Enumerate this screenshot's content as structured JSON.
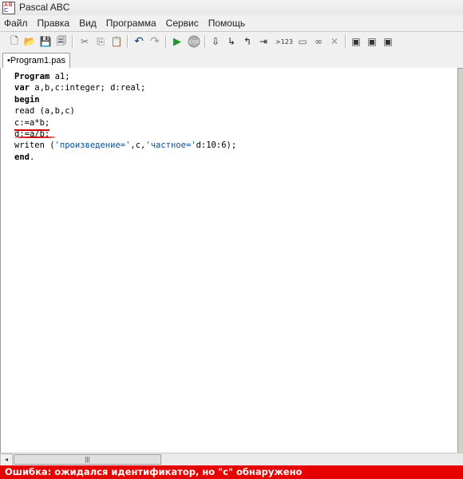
{
  "window": {
    "title": "Pascal ABC"
  },
  "menu": {
    "items": [
      "Файл",
      "Правка",
      "Вид",
      "Программа",
      "Сервис",
      "Помощь"
    ]
  },
  "toolbar": {
    "buttons": [
      {
        "name": "new-file-icon",
        "glyph": "🗋"
      },
      {
        "name": "open-folder-icon",
        "glyph": "📂"
      },
      {
        "name": "save-icon",
        "glyph": "💾"
      },
      {
        "name": "save-all-icon",
        "glyph": "🗐"
      },
      {
        "name": "cut-icon",
        "glyph": "✂"
      },
      {
        "name": "copy-icon",
        "glyph": "⎘"
      },
      {
        "name": "paste-icon",
        "glyph": "📋"
      },
      {
        "name": "undo-icon",
        "glyph": "↶"
      },
      {
        "name": "redo-icon",
        "glyph": "↷"
      },
      {
        "name": "run-icon",
        "glyph": "▶"
      },
      {
        "name": "stop-icon",
        "glyph": "●",
        "label": "STOP"
      },
      {
        "name": "step-over-icon",
        "glyph": "⇩"
      },
      {
        "name": "step-into-icon",
        "glyph": "↳"
      },
      {
        "name": "step-out-icon",
        "glyph": "↰"
      },
      {
        "name": "run-to-cursor-icon",
        "glyph": "⇥"
      },
      {
        "name": "evaluate-icon",
        "glyph": ">123"
      },
      {
        "name": "watch-window-icon",
        "glyph": "▭"
      },
      {
        "name": "breakpoints-icon",
        "glyph": "∞"
      },
      {
        "name": "clear-icon",
        "glyph": "✕"
      },
      {
        "name": "window-1-icon",
        "glyph": "▣"
      },
      {
        "name": "window-2-icon",
        "glyph": "▣"
      },
      {
        "name": "window-3-icon",
        "glyph": "▣"
      }
    ]
  },
  "tabs": [
    {
      "label": "•Program1.pas"
    }
  ],
  "editor": {
    "lines": [
      [
        {
          "t": "Program",
          "c": "kw"
        },
        {
          "t": " a1;",
          "c": ""
        }
      ],
      [
        {
          "t": "var",
          "c": "kw"
        },
        {
          "t": " a,b,c:integer; d:real;",
          "c": ""
        }
      ],
      [
        {
          "t": "begin",
          "c": "kw"
        }
      ],
      [
        {
          "t": "read (a,b,c)",
          "c": ""
        }
      ],
      [
        {
          "t": "c:=a*b;",
          "c": ""
        }
      ],
      [
        {
          "t": "d:=a/b;",
          "c": ""
        }
      ],
      [
        {
          "t": "writen (",
          "c": ""
        },
        {
          "t": "'произведение='",
          "c": "str"
        },
        {
          "t": ",c,",
          "c": ""
        },
        {
          "t": "'частное='",
          "c": "str"
        },
        {
          "t": "d:10:6);",
          "c": ""
        }
      ],
      [
        {
          "t": "end",
          "c": "kw"
        },
        {
          "t": ".",
          "c": ""
        }
      ]
    ]
  },
  "scrollbar": {
    "left_arrow": "◂",
    "thumb_grip": "|||"
  },
  "status": {
    "message": "Ошибка: ожидался идентификатор, но \"c\" обнаружено",
    "color": "#e60000"
  }
}
